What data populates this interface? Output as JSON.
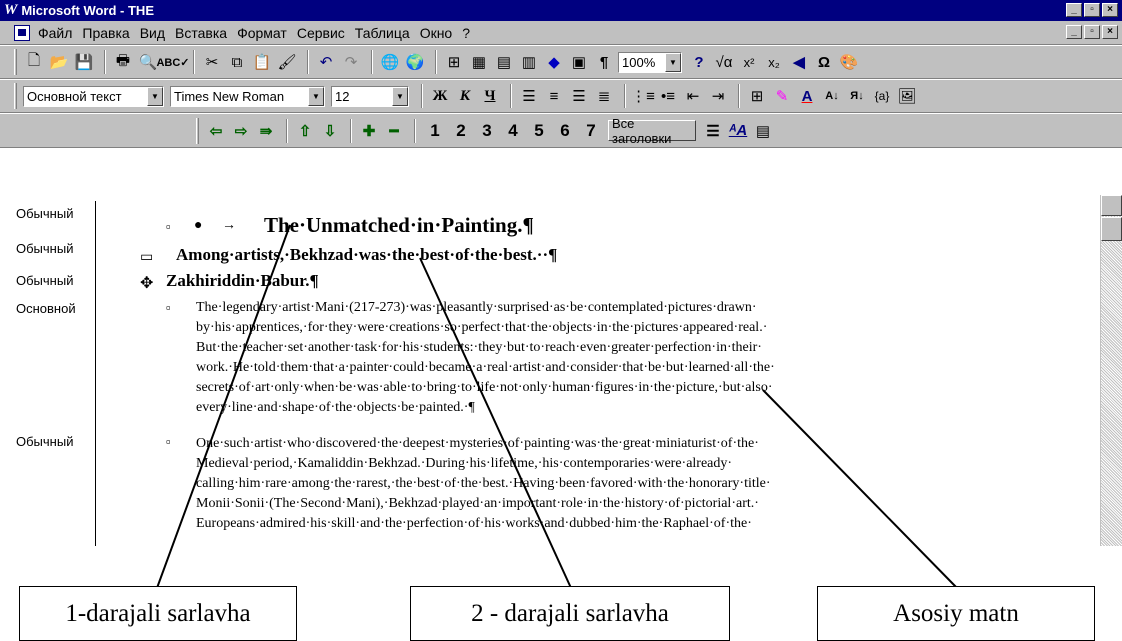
{
  "window": {
    "title": "Microsoft Word - THE"
  },
  "menu": [
    "Файл",
    "Правка",
    "Вид",
    "Вставка",
    "Формат",
    "Сервис",
    "Таблица",
    "Окно",
    "?"
  ],
  "toolbar_formatting": {
    "style_value": "Основной текст",
    "font_value": "Times New Roman",
    "size_value": "12",
    "zoom_value": "100%"
  },
  "outline_toolbar": {
    "levels": [
      "1",
      "2",
      "3",
      "4",
      "5",
      "6",
      "7"
    ],
    "all_headings_label": "Все заголовки"
  },
  "style_area": [
    "Обычный",
    "Обычный",
    "Обычный",
    "Основной",
    "Обычный"
  ],
  "document": {
    "heading1": "The·Unmatched·in·Painting.¶",
    "heading2": "Among·artists,·Bekhzad·was·the·best·of·the·best.··¶",
    "heading2b": "Zakhiriddin·Babur.¶",
    "para1": "The·legendary·artist·Mani·(217-273)·was·pleasantly·surprised·as·be·contemplated·pictures·drawn· by·his·apprentices,·for·they·were·creations·so·perfect·that·the·objects·in·the·pictures·appeared·real.· But·the·teacher·set·another·task·for·his·students:·they·but·to·reach·even·greater·perfection·in·their· work.·He·told·them·that·a·painter·could·became·a·real·artist·and·consider·that·be·but·learned·all·the· secrets·of·art·only·when·be·was·able·to·bring·to·life·not·only·human·figures·in·the·picture,·but·also· every·line·and·shape·of·the·objects·be·painted.·¶",
    "para2": "One·such·artist·who·discovered·the·deepest·mysteries·of·painting·was·the·great·miniaturist·of·the· Medieval·period,·Kamaliddin·Bekhzad.·During·his·lifetime,·his·contemporaries·were·already· calling·him·rare·among·the·rarest,·the·best·of·the·best.·Having·been·favored·with·the·honorary·title· Monii·Sonii·(The·Second·Mani),·Bekhzad·played·an·important·role·in·the·history·of·pictorial·art.· Europeans·admired·his·skill·and·the·perfection·of·his·works·and·dubbed·him·the·Raphael·of·the·"
  },
  "callouts": {
    "heading1_label": "1-darajali sarlavha",
    "heading2_label": "2 - darajali sarlavha",
    "body_label": "Asosiy matn"
  }
}
